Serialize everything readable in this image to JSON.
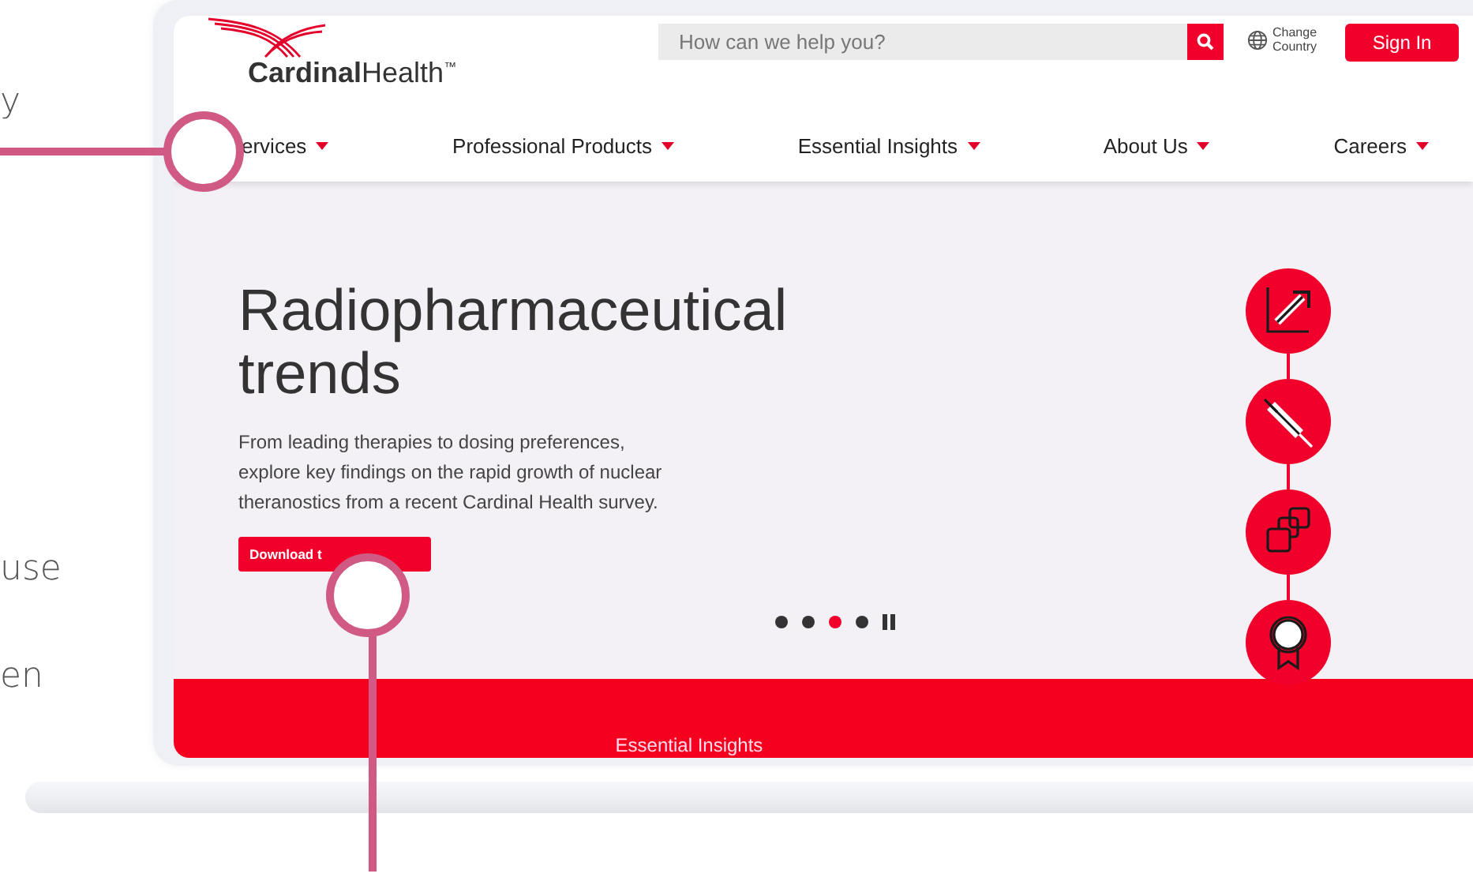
{
  "side_texts": [
    "y",
    "use",
    "en"
  ],
  "header": {
    "logo": "**Cardinal**Health$^{™}$",
    "search": {
      "placeholder": "How can we help you?"
    },
    "country": [
      "Change",
      "Country"
    ],
    "sign_in": "Sign In"
  },
  "nav": [
    {
      "label": "ervices"
    },
    {
      "label": "Professional Products"
    },
    {
      "label": "Essential Insights"
    },
    {
      "label": "About Us"
    },
    {
      "label": "Careers"
    }
  ],
  "hero": {
    "title_lines": [
      "Radiopharmaceutical",
      "trends"
    ],
    "body": "From leading therapies to dosing preferences, explore key findings on the rapid growth of nuclear theranostics from a recent Cardinal Health survey.",
    "button": "Download t",
    "slides": [
      {
        "selected": false
      },
      {
        "selected": false
      },
      {
        "selected": true
      },
      {
        "selected": false
      }
    ],
    "steps": [
      {
        "kind": "chart"
      },
      {
        "kind": "syringe"
      },
      {
        "kind": "boxes"
      },
      {
        "kind": "ribbon"
      }
    ]
  },
  "band": {
    "label": "Essential Insights"
  }
}
